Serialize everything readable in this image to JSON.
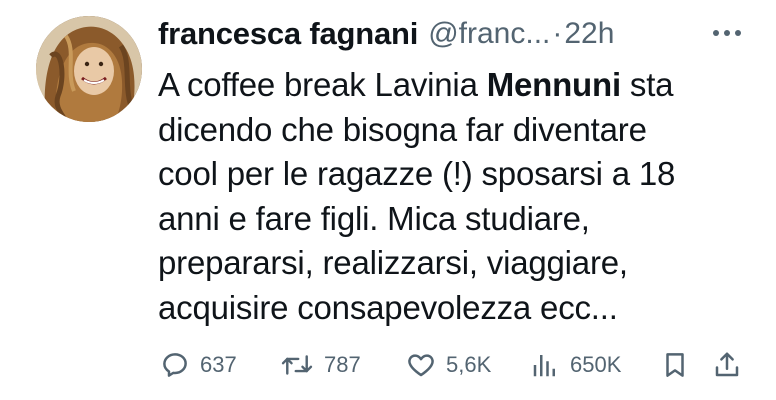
{
  "tweet": {
    "author_name": "francesca fagnani",
    "handle": "@franc...",
    "separator": "·",
    "time": "22h",
    "more_icon": "more-dots-icon",
    "text_lines": [
      {
        "pre": "A coffee break Lavinia ",
        "bold": "Mennuni",
        "post": " sta"
      },
      {
        "text": "dicendo che bisogna far diventare"
      },
      {
        "text": "cool per le ragazze (!) sposarsi a 18"
      },
      {
        "text": "anni e fare figli. Mica studiare,"
      },
      {
        "text": "prepararsi, realizzarsi, viaggiare,"
      },
      {
        "text": "acquisire consapevolezza ecc..."
      }
    ]
  },
  "actions": {
    "reply": {
      "icon": "reply-icon",
      "count": "637"
    },
    "retweet": {
      "icon": "retweet-icon",
      "count": "787"
    },
    "like": {
      "icon": "heart-icon",
      "count": "5,6K"
    },
    "views": {
      "icon": "views-bar-chart-icon",
      "count": "650K"
    },
    "bookmark": {
      "icon": "bookmark-icon"
    },
    "share": {
      "icon": "share-icon"
    }
  },
  "colors": {
    "text": "#0f1419",
    "secondary": "#536471",
    "background": "#ffffff"
  }
}
